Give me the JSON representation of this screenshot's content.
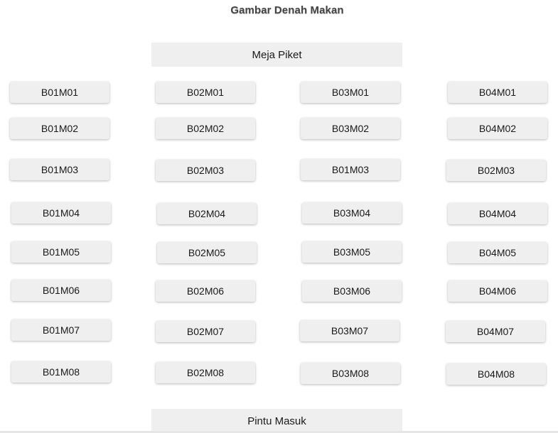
{
  "title": "Gambar Denah Makan",
  "top_bar_label": "Meja Piket",
  "bottom_bar_label": "Pintu Masuk",
  "tables": [
    [
      "B01M01",
      "B02M01",
      "B03M01",
      "B04M01"
    ],
    [
      "B01M02",
      "B02M02",
      "B03M02",
      "B04M02"
    ],
    [
      "B01M03",
      "B02M03",
      "B01M03",
      "B02M03"
    ],
    [
      "B01M04",
      "B02M04",
      "B03M04",
      "B04M04"
    ],
    [
      "B01M05",
      "B02M05",
      "B03M05",
      "B04M05"
    ],
    [
      "B01M06",
      "B02M06",
      "B03M06",
      "B04M06"
    ],
    [
      "B01M07",
      "B02M07",
      "B03M07",
      "B04M07"
    ],
    [
      "B01M08",
      "B02M08",
      "B03M08",
      "B04M08"
    ]
  ]
}
